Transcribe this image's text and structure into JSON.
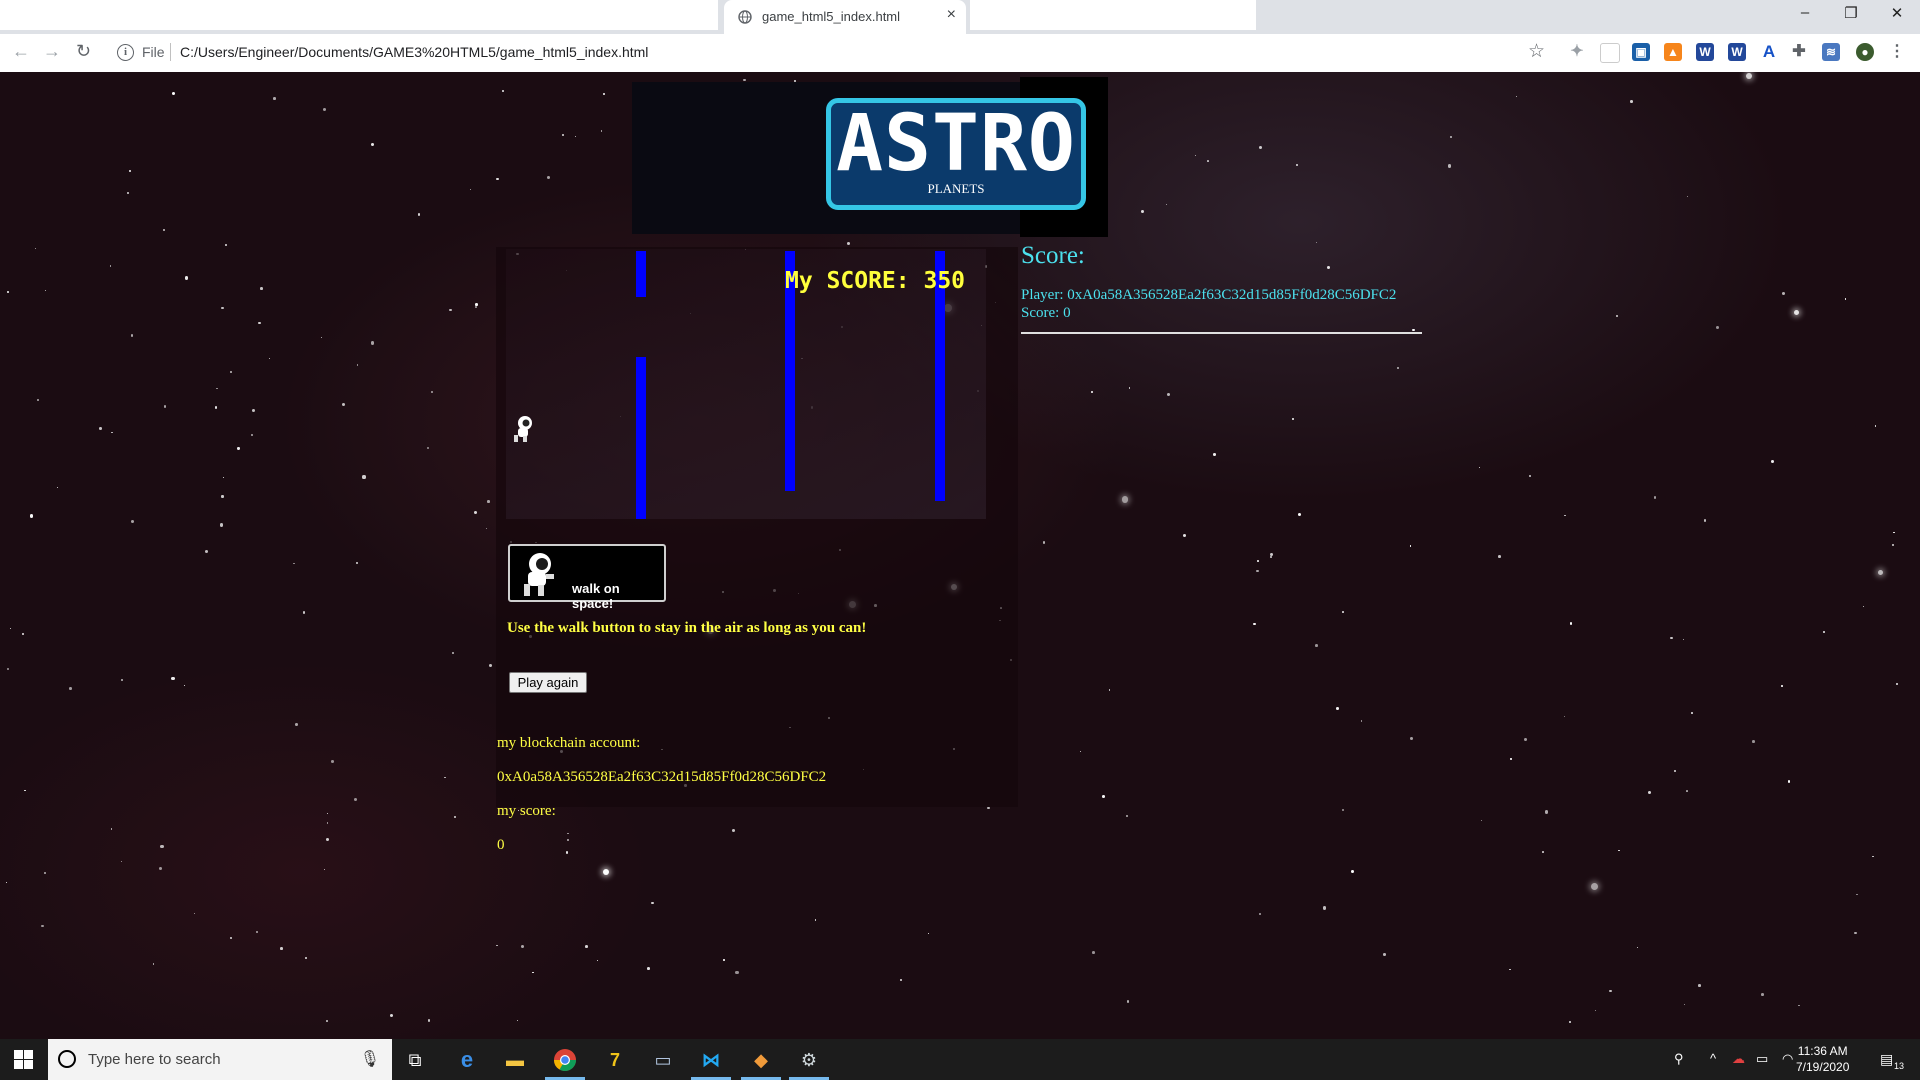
{
  "browser": {
    "tab_title": "game_html5_index.html",
    "tab_close": "×",
    "address_scheme": "File",
    "address_url": "C:/Users/Engineer/Documents/GAME3%20HTML5/game_html5_index.html",
    "window_controls": [
      "–",
      "❐",
      "✕"
    ]
  },
  "logo": {
    "title": "ASTRO",
    "subtitle": "PLANETS"
  },
  "game": {
    "canvas_score": "My SCORE: 350",
    "walk_button_label": "walk on space!",
    "instructions": "Use the walk button to stay in the air as long as you can!",
    "play_again_label": "Play again"
  },
  "account": {
    "account_label": "my blockchain account:",
    "account_value": "0xA0a58A356528Ea2f63C32d15d85Ff0d28C56DFC2",
    "score_label": "my score:",
    "score_value": "0"
  },
  "scoreboard": {
    "heading": "Score:",
    "player_line": "Player: 0xA0a58A356528Ea2f63C32d15d85Ff0d28C56DFC2",
    "score_line": "Score: 0"
  },
  "taskbar": {
    "search_placeholder": "Type here to search",
    "time": "11:36 AM",
    "date": "7/19/2020",
    "notification_count": "13"
  },
  "colors": {
    "pipe": "#0000ff",
    "canvas_score": "#ffff3c",
    "instructions": "#ffff44",
    "scoreboard": "#4ce1ee",
    "logo_border": "#35c6e6",
    "logo_fill": "#0b3a6b"
  },
  "icons": [
    "globe-icon",
    "back-arrow-icon",
    "forward-arrow-icon",
    "reload-icon",
    "info-icon",
    "bookmark-star-icon",
    "extensions-icon",
    "profile-icon",
    "menu-icon",
    "windows-start-icon",
    "microphone-icon",
    "task-view-icon",
    "edge-icon",
    "file-explorer-icon",
    "chrome-icon",
    "astronaut-icon"
  ]
}
